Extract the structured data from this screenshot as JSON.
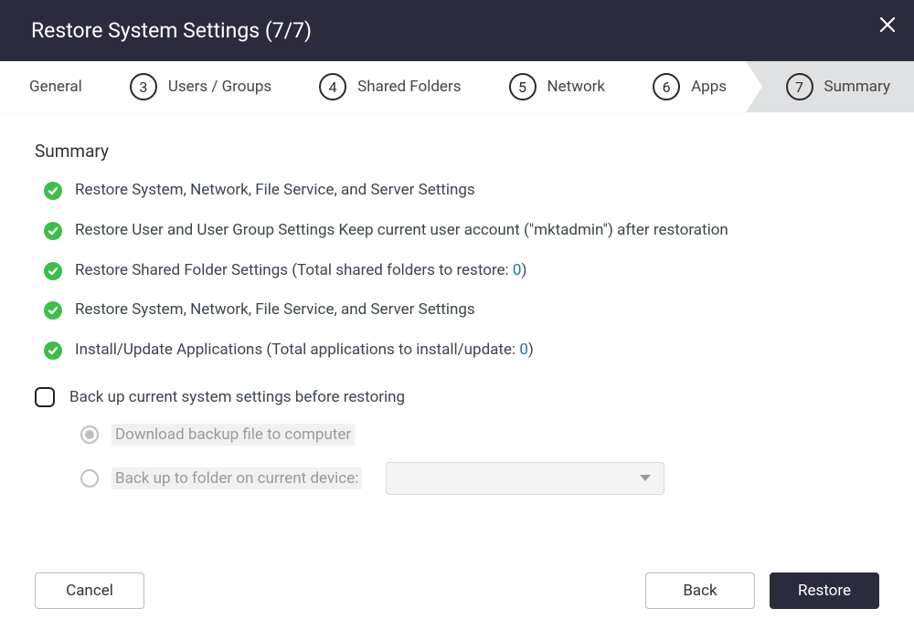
{
  "header": {
    "title": "Restore System Settings (7/7)"
  },
  "stepper": {
    "partialFirstLabel": "General",
    "steps": [
      {
        "num": "3",
        "label": "Users / Groups"
      },
      {
        "num": "4",
        "label": "Shared Folders"
      },
      {
        "num": "5",
        "label": "Network"
      },
      {
        "num": "6",
        "label": "Apps"
      },
      {
        "num": "7",
        "label": "Summary",
        "active": true
      }
    ]
  },
  "summary": {
    "title": "Summary",
    "items": [
      {
        "text": "Restore System, Network, File Service, and Server Settings"
      },
      {
        "text": "Restore User and User Group Settings Keep current user account (\"mktadmin\") after restoration"
      },
      {
        "prefix": "Restore Shared Folder Settings (Total shared folders to restore: ",
        "count": "0",
        "suffix": ")"
      },
      {
        "text": "Restore System, Network, File Service, and Server Settings"
      },
      {
        "prefix": "Install/Update Applications (Total applications to install/update: ",
        "count": "0",
        "suffix": ")"
      }
    ]
  },
  "backup": {
    "checkboxLabel": "Back up current system settings before restoring",
    "options": {
      "download": "Download backup file to computer",
      "folder": "Back up to folder on current device:"
    }
  },
  "footer": {
    "cancel": "Cancel",
    "back": "Back",
    "restore": "Restore"
  }
}
